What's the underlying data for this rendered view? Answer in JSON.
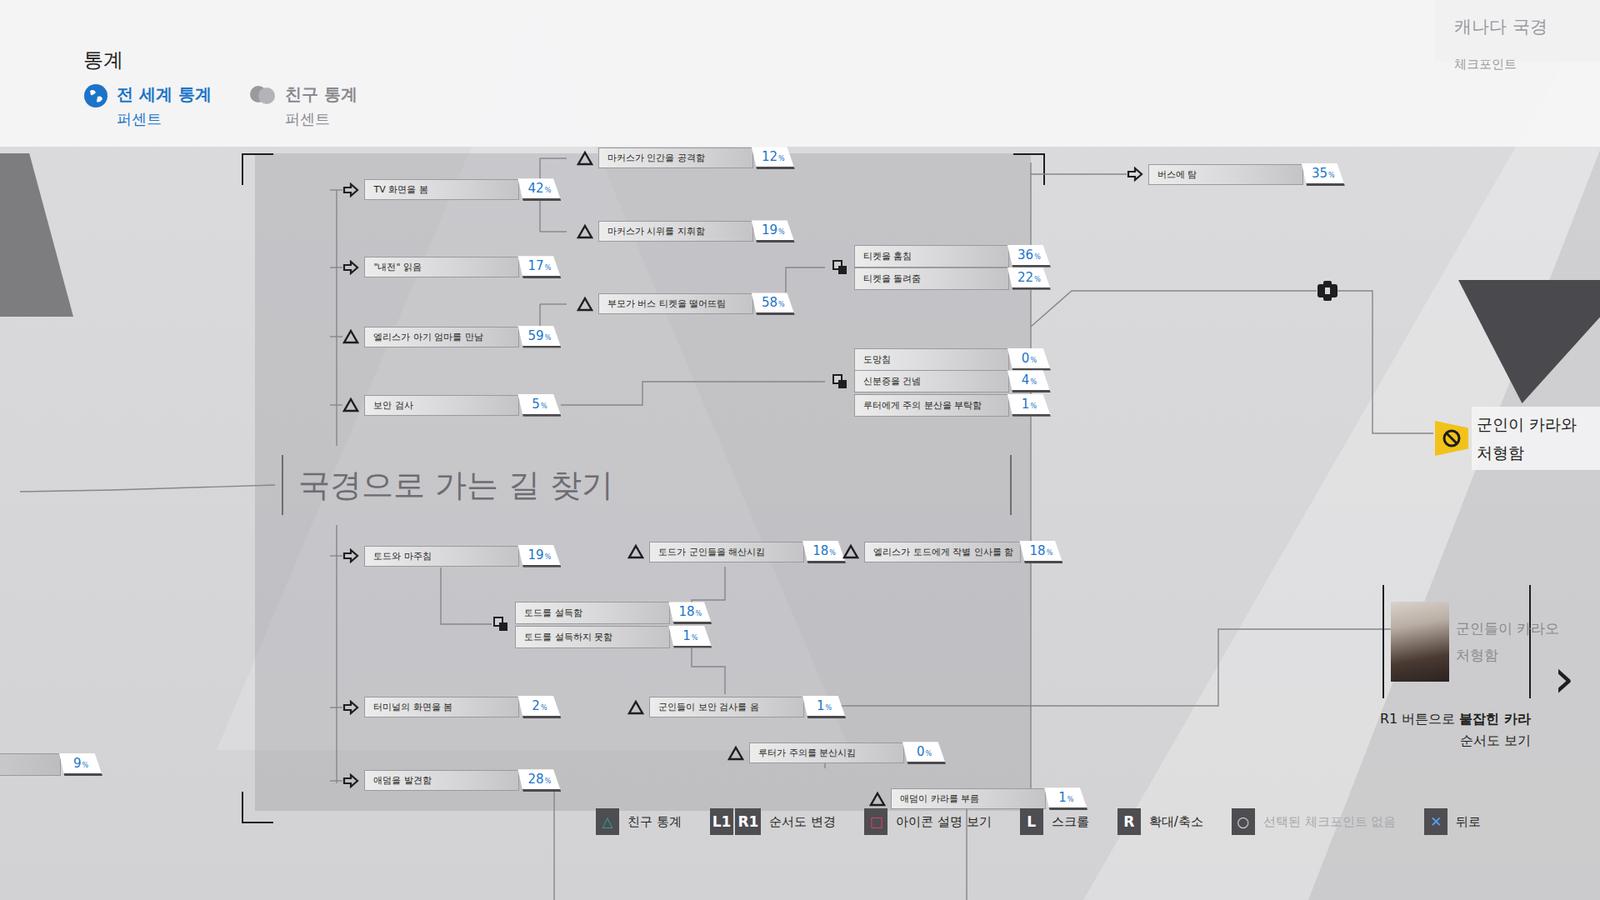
{
  "header": {
    "title": "통계",
    "tabs": [
      {
        "label": "전 세계 통계",
        "sub": "퍼센트",
        "selected": true
      },
      {
        "label": "친구 통계",
        "sub": "퍼센트",
        "selected": false
      }
    ]
  },
  "checkpoint": {
    "title": "캐나다 국경",
    "sub": "체크포인트"
  },
  "chapter": {
    "title": "국경으로 가는 길 찾기"
  },
  "left_stub": {
    "value": "9",
    "unit": "%"
  },
  "nodes": [
    {
      "label": "TV 화면을 봄",
      "value": "42",
      "unit": "%",
      "kind": "action"
    },
    {
      "label": "\"내전\" 읽음",
      "value": "17",
      "unit": "%",
      "kind": "action"
    },
    {
      "label": "엘리스가 아기 엄마를 만남",
      "value": "59",
      "unit": "%",
      "kind": "story"
    },
    {
      "label": "보안 검사",
      "value": "5",
      "unit": "%",
      "kind": "story"
    },
    {
      "label": "마커스가 인간을 공격함",
      "value": "12",
      "unit": "%",
      "kind": "story"
    },
    {
      "label": "마커스가 시위를 지휘함",
      "value": "19",
      "unit": "%",
      "kind": "story"
    },
    {
      "label": "부모가 버스 티켓을 떨어뜨림",
      "value": "58",
      "unit": "%",
      "kind": "story"
    },
    {
      "label": "티켓을 훔침",
      "value": "36",
      "unit": "%",
      "kind": "choice"
    },
    {
      "label": "티켓을 돌려줌",
      "value": "22",
      "unit": "%",
      "kind": "choice"
    },
    {
      "label": "도망침",
      "value": "0",
      "unit": "%",
      "kind": "choice"
    },
    {
      "label": "신분증을 건넴",
      "value": "4",
      "unit": "%",
      "kind": "choice"
    },
    {
      "label": "루터에게 주의 분산을 부탁함",
      "value": "1",
      "unit": "%",
      "kind": "choice"
    },
    {
      "label": "버스에 탐",
      "value": "35",
      "unit": "%",
      "kind": "action"
    },
    {
      "label": "토드와 마주침",
      "value": "19",
      "unit": "%",
      "kind": "action"
    },
    {
      "label": "토드를 설득함",
      "value": "18",
      "unit": "%",
      "kind": "choice"
    },
    {
      "label": "토드를 설득하지 못함",
      "value": "1",
      "unit": "%",
      "kind": "choice"
    },
    {
      "label": "토드가 군인들을 해산시킴",
      "value": "18",
      "unit": "%",
      "kind": "story"
    },
    {
      "label": "엘리스가 토드에게 작별 인사를 함",
      "value": "18",
      "unit": "%",
      "kind": "story"
    },
    {
      "label": "터미널의 화면을 봄",
      "value": "2",
      "unit": "%",
      "kind": "action"
    },
    {
      "label": "군인들이 보안 검사를 옴",
      "value": "1",
      "unit": "%",
      "kind": "story"
    },
    {
      "label": "루터가 주의를 분산시킴",
      "value": "0",
      "unit": "%",
      "kind": "story"
    },
    {
      "label": "애덤을 발견함",
      "value": "28",
      "unit": "%",
      "kind": "action"
    },
    {
      "label": "애덤이 카라를 부름",
      "value": "1",
      "unit": "%",
      "kind": "story"
    }
  ],
  "ending": {
    "lines": [
      "군인이 카라와",
      "처형함"
    ],
    "locked": true
  },
  "preview": {
    "lines": [
      "군인들이 카라오",
      "처형함"
    ],
    "caption_prefix": "R1 버튼으로 ",
    "caption_bold": "붙잡힌 카라",
    "caption_line2": "순서도 보기",
    "chevron": "›"
  },
  "bottom_bar": [
    {
      "keys": [
        "△"
      ],
      "label": "친구 통계",
      "color": "#2fa38a",
      "disabled": false
    },
    {
      "keys": [
        "L1",
        "R1"
      ],
      "label": "순서도 변경",
      "color": "#ffffff",
      "disabled": false
    },
    {
      "keys": [
        "□"
      ],
      "label": "아이콘 설명 보기",
      "color": "#d8405e",
      "disabled": false
    },
    {
      "keys": [
        "L"
      ],
      "label": "스크롤",
      "color": "#ffffff",
      "disabled": false
    },
    {
      "keys": [
        "R"
      ],
      "label": "확대/축소",
      "color": "#ffffff",
      "disabled": false
    },
    {
      "keys": [
        "○"
      ],
      "label": "선택된 체크포인트 없음",
      "color": "#d8d8da",
      "disabled": true
    },
    {
      "keys": [
        "✕"
      ],
      "label": "뒤로",
      "color": "#5aa0ee",
      "disabled": false
    }
  ]
}
